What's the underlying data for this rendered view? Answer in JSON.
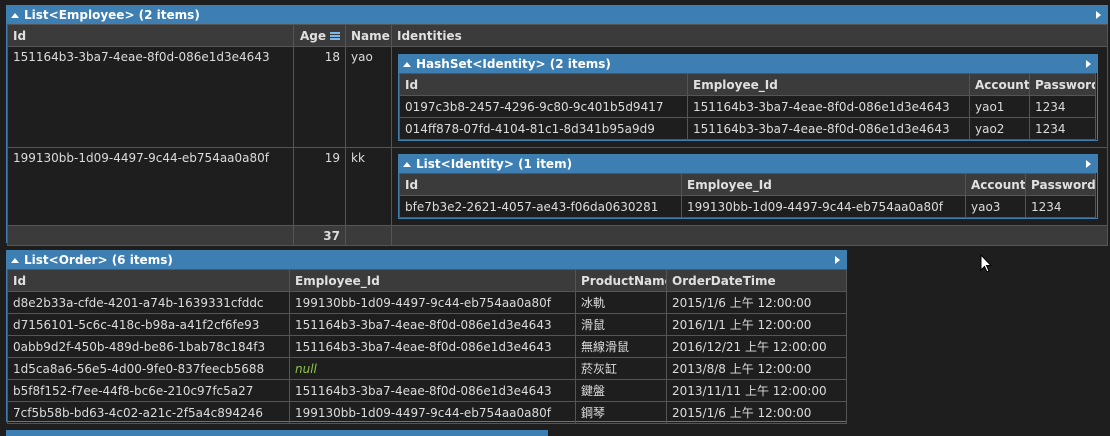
{
  "employee_panel": {
    "title": "List<Employee> (2 items)",
    "columns": [
      "Id",
      "Age",
      "Name",
      "Identities"
    ],
    "rows": [
      {
        "id": "151164b3-3ba7-4eae-8f0d-086e1d3e4643",
        "age": "18",
        "name": "yao",
        "identities": {
          "title": "HashSet<Identity> (2 items)",
          "columns": [
            "Id",
            "Employee_Id",
            "Account",
            "Password"
          ],
          "rows": [
            [
              "0197c3b8-2457-4296-9c80-9c401b5d9417",
              "151164b3-3ba7-4eae-8f0d-086e1d3e4643",
              "yao1",
              "1234"
            ],
            [
              "014ff878-07fd-4104-81c1-8d341b95a9d9",
              "151164b3-3ba7-4eae-8f0d-086e1d3e4643",
              "yao2",
              "1234"
            ]
          ]
        }
      },
      {
        "id": "199130bb-1d09-4497-9c44-eb754aa0a80f",
        "age": "19",
        "name": "kk",
        "identities": {
          "title": "List<Identity> (1 item)",
          "columns": [
            "Id",
            "Employee_Id",
            "Account",
            "Password"
          ],
          "rows": [
            [
              "bfe7b3e2-2621-4057-ae43-f06da0630281",
              "199130bb-1d09-4497-9c44-eb754aa0a80f",
              "yao3",
              "1234"
            ]
          ]
        }
      }
    ],
    "age_total": "37"
  },
  "order_panel": {
    "title": "List<Order> (6 items)",
    "columns": [
      "Id",
      "Employee_Id",
      "ProductName",
      "OrderDateTime"
    ],
    "rows": [
      [
        "d8e2b33a-cfde-4201-a74b-1639331cfddc",
        "199130bb-1d09-4497-9c44-eb754aa0a80f",
        "冰軌",
        "2015/1/6 上午 12:00:00"
      ],
      [
        "d7156101-5c6c-418c-b98a-a41f2cf6fe93",
        "151164b3-3ba7-4eae-8f0d-086e1d3e4643",
        "滑鼠",
        "2016/1/1 上午 12:00:00"
      ],
      [
        "0abb9d2f-450b-489d-be86-1bab78c184f3",
        "151164b3-3ba7-4eae-8f0d-086e1d3e4643",
        "無線滑鼠",
        "2016/12/21 上午 12:00:00"
      ],
      [
        "1d5ca8a6-56e5-4d00-9fe0-837feecb5688",
        "null",
        "菸灰缸",
        "2013/8/8 上午 12:00:00"
      ],
      [
        "b5f8f152-f7ee-44f8-bc6e-210c97fc5a27",
        "151164b3-3ba7-4eae-8f0d-086e1d3e4643",
        "鍵盤",
        "2013/11/11 上午 12:00:00"
      ],
      [
        "7cf5b58b-bd63-4c02-a21c-2f5a4c894246",
        "199130bb-1d09-4497-9c44-eb754aa0a80f",
        "鋼琴",
        "2015/1/6 上午 12:00:00"
      ]
    ]
  },
  "icons": {
    "collapse": "collapse-triangle-icon",
    "expand": "expand-arrow-icon",
    "sort": "sort-icon"
  },
  "colors": {
    "header_blue": "#3d7fb3",
    "null_green": "#8bc34a",
    "background": "#1e1e1e"
  }
}
